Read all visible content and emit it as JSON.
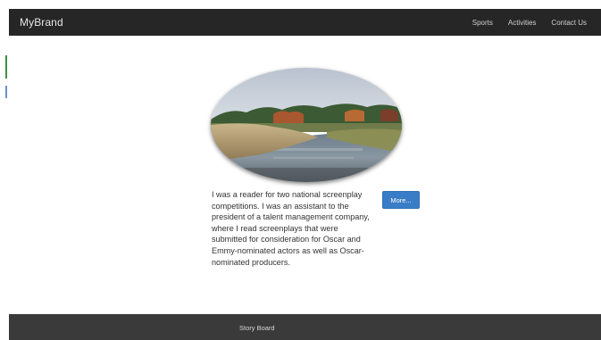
{
  "navbar": {
    "brand": "MyBrand",
    "links": [
      "Sports",
      "Activities",
      "Contact Us"
    ]
  },
  "hero": {
    "image": "landscape-photo-river-marsh",
    "shape": "oval"
  },
  "content": {
    "bio": "I was a reader for two national screenplay competitions. I was an assistant to the president of a talent management company, where I read screenplays that were submitted for consideration for Oscar and Emmy-nominated actors as well as Oscar-nominated producers.",
    "more_label": "More..."
  },
  "footer": {
    "text": "Story Board"
  },
  "colors": {
    "navbar_bg": "#262626",
    "footer_bg": "#3a3a3a",
    "button_bg": "#3a7dc6"
  }
}
